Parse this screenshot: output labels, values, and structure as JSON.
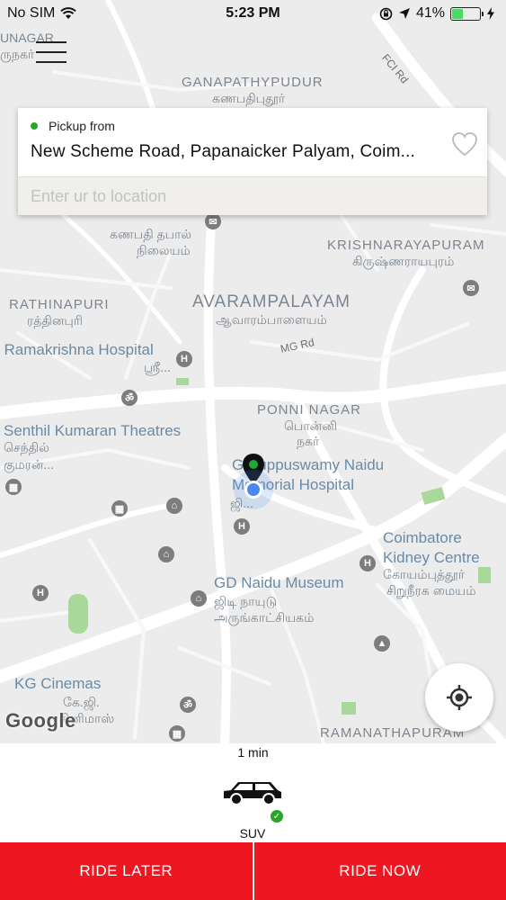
{
  "status_bar": {
    "carrier": "No SIM",
    "time": "5:23 PM",
    "battery_percent": "41%",
    "battery_level": 0.41,
    "battery_color": "#4cd964"
  },
  "map": {
    "labels": {
      "unagar": "UNAGAR",
      "unagar_ta": "ருநகர்",
      "ganapathypudur": "GANAPATHYPUDUR",
      "ganapathypudur_ta": "கணபதிபுதூர்",
      "fci_rd": "FCI Rd",
      "ganapathy_thabal": "கணபதி தபால்",
      "ganapathy_nilayam": "நிலையம்",
      "krishnarayapuram": "KRISHNARAYAPURAM",
      "krishnarayapuram_ta": "கிருஷ்ணராயபுரம்",
      "rathinapuri": "RATHINAPURI",
      "rathinapuri_ta": "ரத்தினபுரி",
      "avarampalayam": "AVARAMPALAYAM",
      "avarampalayam_ta": "ஆவாரம்பாளையம்",
      "mg_rd": "MG Rd",
      "ramakrishna_hospital": "i Ramakrishna Hospital",
      "ramakrishna_ta": "ஸ்ரீ...",
      "ponni_nagar": "PONNI NAGAR",
      "ponni_ta_1": "பொன்னி",
      "ponni_ta_2": "நகர்",
      "senthil_theatres": "Senthil Kumaran Theatres",
      "senthil_ta_1": "செந்தில்",
      "senthil_ta_2": "குமரன்...",
      "gkuppuswamy_1": "G Kuppuswamy Naidu",
      "gkuppuswamy_2": "Memorial Hospital",
      "gkuppuswamy_ta": "ஜி...",
      "kidney_centre_1": "Coimbatore",
      "kidney_centre_2": "Kidney Centre",
      "kidney_ta_1": "கோயம்புத்தூர்",
      "kidney_ta_2": "சிறுநீரக மையம்",
      "gd_naidu_museum": "GD Naidu Museum",
      "gd_naidu_ta_1": "ஜிடி நாயுடு",
      "gd_naidu_ta_2": "அருங்காட்சியகம்",
      "kg_cinemas": "KG Cinemas",
      "kg_ta_1": "கே.ஜி.",
      "kg_ta_2": "சினிமாஸ்",
      "ramanathapuram": "RAMANATHAPURAM",
      "google": "Google"
    }
  },
  "location_card": {
    "pickup_label": "Pickup from",
    "pickup_address": "New Scheme Road, Papanaicker Palyam, Coim...",
    "destination_placeholder": "Enter ur to location"
  },
  "booking": {
    "eta": "1 min",
    "vehicle_name": "SUV",
    "ride_later_label": "RIDE LATER",
    "ride_now_label": "RIDE NOW",
    "accent_color": "#ee1620"
  }
}
